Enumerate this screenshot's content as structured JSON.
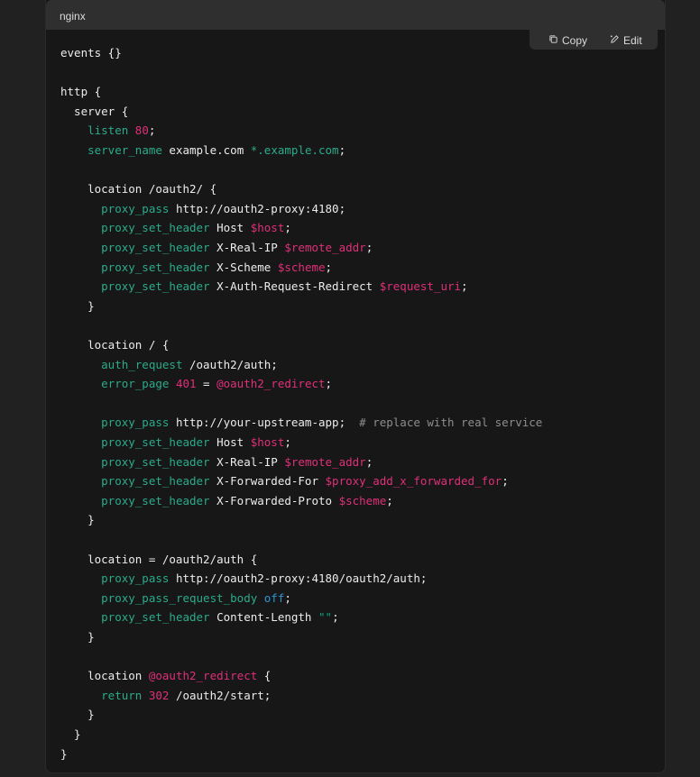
{
  "header": {
    "language": "nginx",
    "copy_label": "Copy",
    "edit_label": "Edit"
  },
  "icons": {
    "copy": "copy-icon",
    "edit": "pencil-icon"
  },
  "colors": {
    "background": "#212121",
    "code_bg": "#171717",
    "header_bg": "#2f2f2f",
    "directive": "#2bab8a",
    "variable": "#df3079",
    "number": "#df3079",
    "comment": "#8e8e8e",
    "keyword_off": "#2e95d3",
    "plain": "#ececec"
  },
  "code": {
    "lines": [
      [
        {
          "t": "events {}",
          "c": "plain"
        }
      ],
      [],
      [
        {
          "t": "http {",
          "c": "plain"
        }
      ],
      [
        {
          "t": "  server {",
          "c": "plain"
        }
      ],
      [
        {
          "t": "    ",
          "c": "plain"
        },
        {
          "t": "listen",
          "c": "kw"
        },
        {
          "t": " ",
          "c": "plain"
        },
        {
          "t": "80",
          "c": "num"
        },
        {
          "t": ";",
          "c": "plain"
        }
      ],
      [
        {
          "t": "    ",
          "c": "plain"
        },
        {
          "t": "server_name",
          "c": "kw"
        },
        {
          "t": " example.com ",
          "c": "plain"
        },
        {
          "t": "*.example.com",
          "c": "kw"
        },
        {
          "t": ";",
          "c": "plain"
        }
      ],
      [],
      [
        {
          "t": "    location /oauth2/ {",
          "c": "plain"
        }
      ],
      [
        {
          "t": "      ",
          "c": "plain"
        },
        {
          "t": "proxy_pass",
          "c": "kw"
        },
        {
          "t": " http://oauth2-proxy:4180;",
          "c": "plain"
        }
      ],
      [
        {
          "t": "      ",
          "c": "plain"
        },
        {
          "t": "proxy_set_header",
          "c": "kw"
        },
        {
          "t": " Host ",
          "c": "plain"
        },
        {
          "t": "$host",
          "c": "var"
        },
        {
          "t": ";",
          "c": "plain"
        }
      ],
      [
        {
          "t": "      ",
          "c": "plain"
        },
        {
          "t": "proxy_set_header",
          "c": "kw"
        },
        {
          "t": " X-Real-IP ",
          "c": "plain"
        },
        {
          "t": "$remote_addr",
          "c": "var"
        },
        {
          "t": ";",
          "c": "plain"
        }
      ],
      [
        {
          "t": "      ",
          "c": "plain"
        },
        {
          "t": "proxy_set_header",
          "c": "kw"
        },
        {
          "t": " X-Scheme ",
          "c": "plain"
        },
        {
          "t": "$scheme",
          "c": "var"
        },
        {
          "t": ";",
          "c": "plain"
        }
      ],
      [
        {
          "t": "      ",
          "c": "plain"
        },
        {
          "t": "proxy_set_header",
          "c": "kw"
        },
        {
          "t": " X-Auth-Request-Redirect ",
          "c": "plain"
        },
        {
          "t": "$request_uri",
          "c": "var"
        },
        {
          "t": ";",
          "c": "plain"
        }
      ],
      [
        {
          "t": "    }",
          "c": "plain"
        }
      ],
      [],
      [
        {
          "t": "    location / {",
          "c": "plain"
        }
      ],
      [
        {
          "t": "      ",
          "c": "plain"
        },
        {
          "t": "auth_request",
          "c": "kw"
        },
        {
          "t": " /oauth2/auth;",
          "c": "plain"
        }
      ],
      [
        {
          "t": "      ",
          "c": "plain"
        },
        {
          "t": "error_page",
          "c": "kw"
        },
        {
          "t": " ",
          "c": "plain"
        },
        {
          "t": "401",
          "c": "num"
        },
        {
          "t": " = ",
          "c": "plain"
        },
        {
          "t": "@oauth2_redirect",
          "c": "var"
        },
        {
          "t": ";",
          "c": "plain"
        }
      ],
      [],
      [
        {
          "t": "      ",
          "c": "plain"
        },
        {
          "t": "proxy_pass",
          "c": "kw"
        },
        {
          "t": " http://your-upstream-app;  ",
          "c": "plain"
        },
        {
          "t": "# replace with real service",
          "c": "cmt"
        }
      ],
      [
        {
          "t": "      ",
          "c": "plain"
        },
        {
          "t": "proxy_set_header",
          "c": "kw"
        },
        {
          "t": " Host ",
          "c": "plain"
        },
        {
          "t": "$host",
          "c": "var"
        },
        {
          "t": ";",
          "c": "plain"
        }
      ],
      [
        {
          "t": "      ",
          "c": "plain"
        },
        {
          "t": "proxy_set_header",
          "c": "kw"
        },
        {
          "t": " X-Real-IP ",
          "c": "plain"
        },
        {
          "t": "$remote_addr",
          "c": "var"
        },
        {
          "t": ";",
          "c": "plain"
        }
      ],
      [
        {
          "t": "      ",
          "c": "plain"
        },
        {
          "t": "proxy_set_header",
          "c": "kw"
        },
        {
          "t": " X-Forwarded-For ",
          "c": "plain"
        },
        {
          "t": "$proxy_add_x_forwarded_for",
          "c": "var"
        },
        {
          "t": ";",
          "c": "plain"
        }
      ],
      [
        {
          "t": "      ",
          "c": "plain"
        },
        {
          "t": "proxy_set_header",
          "c": "kw"
        },
        {
          "t": " X-Forwarded-Proto ",
          "c": "plain"
        },
        {
          "t": "$scheme",
          "c": "var"
        },
        {
          "t": ";",
          "c": "plain"
        }
      ],
      [
        {
          "t": "    }",
          "c": "plain"
        }
      ],
      [],
      [
        {
          "t": "    location = /oauth2/auth {",
          "c": "plain"
        }
      ],
      [
        {
          "t": "      ",
          "c": "plain"
        },
        {
          "t": "proxy_pass",
          "c": "kw"
        },
        {
          "t": " http://oauth2-proxy:4180/oauth2/auth;",
          "c": "plain"
        }
      ],
      [
        {
          "t": "      ",
          "c": "plain"
        },
        {
          "t": "proxy_pass_request_body",
          "c": "kw"
        },
        {
          "t": " ",
          "c": "plain"
        },
        {
          "t": "off",
          "c": "bool"
        },
        {
          "t": ";",
          "c": "plain"
        }
      ],
      [
        {
          "t": "      ",
          "c": "plain"
        },
        {
          "t": "proxy_set_header",
          "c": "kw"
        },
        {
          "t": " Content-Length ",
          "c": "plain"
        },
        {
          "t": "\"\"",
          "c": "str"
        },
        {
          "t": ";",
          "c": "plain"
        }
      ],
      [
        {
          "t": "    }",
          "c": "plain"
        }
      ],
      [],
      [
        {
          "t": "    location ",
          "c": "plain"
        },
        {
          "t": "@oauth2_redirect",
          "c": "var"
        },
        {
          "t": " {",
          "c": "plain"
        }
      ],
      [
        {
          "t": "      ",
          "c": "plain"
        },
        {
          "t": "return",
          "c": "kw"
        },
        {
          "t": " ",
          "c": "plain"
        },
        {
          "t": "302",
          "c": "num"
        },
        {
          "t": " /oauth2/start;",
          "c": "plain"
        }
      ],
      [
        {
          "t": "    }",
          "c": "plain"
        }
      ],
      [
        {
          "t": "  }",
          "c": "plain"
        }
      ],
      [
        {
          "t": "}",
          "c": "plain"
        }
      ]
    ]
  }
}
